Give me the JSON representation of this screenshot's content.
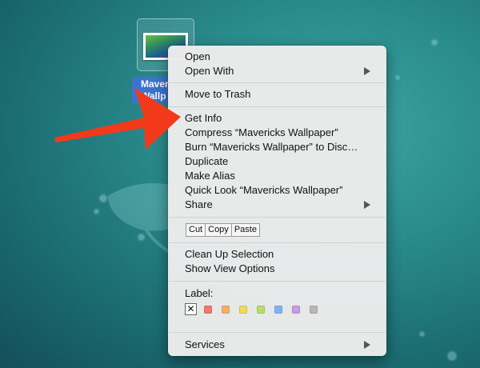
{
  "desktop": {
    "file": {
      "label_line1": "Maver",
      "label_line2": "Wallp"
    }
  },
  "menu": {
    "open": "Open",
    "open_with": "Open With",
    "move_to_trash": "Move to Trash",
    "get_info": "Get Info",
    "compress": "Compress “Mavericks Wallpaper”",
    "burn": "Burn “Mavericks Wallpaper” to Disc…",
    "duplicate": "Duplicate",
    "make_alias": "Make Alias",
    "quick_look": "Quick Look “Mavericks Wallpaper”",
    "share": "Share",
    "cut": "Cut",
    "copy": "Copy",
    "paste": "Paste",
    "clean_up": "Clean Up Selection",
    "view_options": "Show View Options",
    "label_heading": "Label:",
    "label_none_glyph": "✕",
    "services": "Services"
  },
  "label_colors": [
    "#f07a6d",
    "#f6b06a",
    "#f0da5c",
    "#b7dd6a",
    "#7fb3f0",
    "#c99ae8",
    "#b8b8b8"
  ],
  "annotation": {
    "arrow_color": "#f23a1a"
  },
  "icons": {
    "submenu": "chevron-right-icon",
    "thumbnail": "wallpaper-thumbnail-icon"
  }
}
